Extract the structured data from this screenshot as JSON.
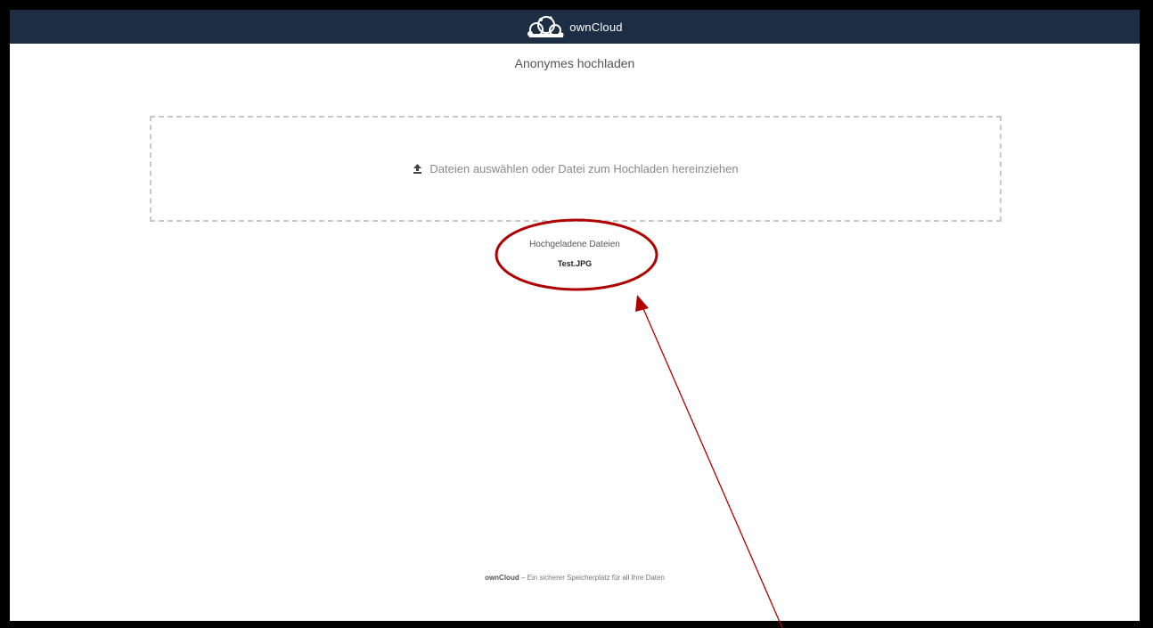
{
  "header": {
    "brand": "ownCloud",
    "background": "#1d2d44"
  },
  "main": {
    "title": "Anonymes hochladen",
    "dropzone": {
      "icon": "upload-icon",
      "label": "Dateien auswählen oder Datei zum Hochladen hereinziehen"
    },
    "uploaded": {
      "title": "Hochgeladene Dateien",
      "files": [
        "Test.JPG"
      ]
    }
  },
  "footer": {
    "brand": "ownCloud",
    "tagline": " – Ein sicherer Speicherplatz für all Ihre Daten"
  },
  "annotation": {
    "color": "#b00000",
    "shape": "ellipse-with-arrow"
  }
}
